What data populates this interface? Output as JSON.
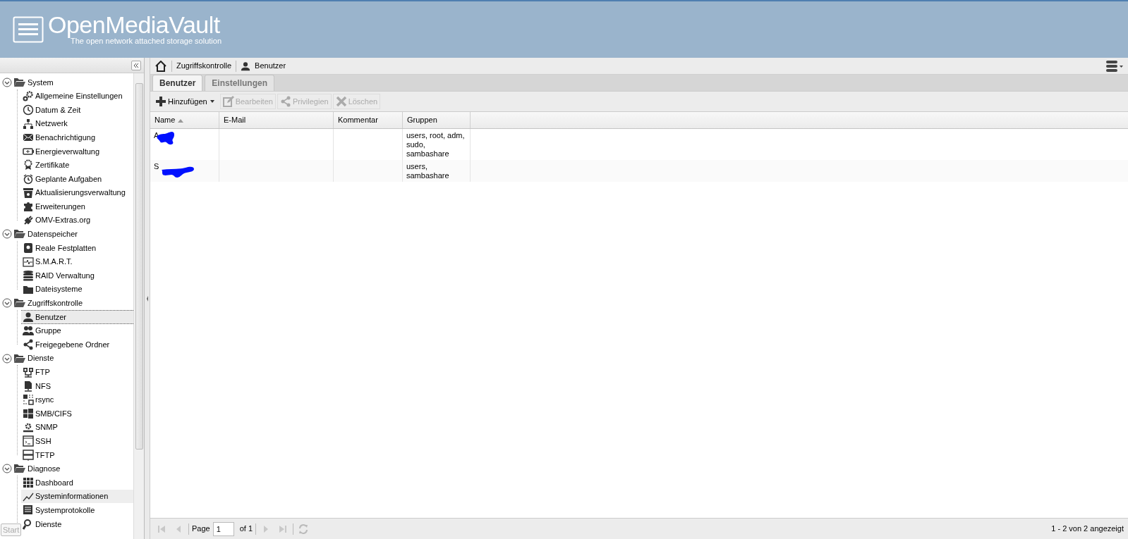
{
  "header": {
    "title": "OpenMediaVault",
    "tagline": "The open network attached storage solution"
  },
  "sidebar": {
    "tree": [
      {
        "label": "System",
        "expanded": true,
        "children": [
          {
            "label": "Allgemeine Einstellungen",
            "selected": false,
            "hovered": false
          },
          {
            "label": "Datum & Zeit",
            "selected": false,
            "hovered": false
          },
          {
            "label": "Netzwerk",
            "selected": false,
            "hovered": false
          },
          {
            "label": "Benachrichtigung",
            "selected": false,
            "hovered": false
          },
          {
            "label": "Energieverwaltung",
            "selected": false,
            "hovered": false
          },
          {
            "label": "Zertifikate",
            "selected": false,
            "hovered": false
          },
          {
            "label": "Geplante Aufgaben",
            "selected": false,
            "hovered": false
          },
          {
            "label": "Aktualisierungsverwaltung",
            "selected": false,
            "hovered": false
          },
          {
            "label": "Erweiterungen",
            "selected": false,
            "hovered": false
          },
          {
            "label": "OMV-Extras.org",
            "selected": false,
            "hovered": false
          }
        ]
      },
      {
        "label": "Datenspeicher",
        "expanded": true,
        "children": [
          {
            "label": "Reale Festplatten",
            "selected": false,
            "hovered": false
          },
          {
            "label": "S.M.A.R.T.",
            "selected": false,
            "hovered": false
          },
          {
            "label": "RAID Verwaltung",
            "selected": false,
            "hovered": false
          },
          {
            "label": "Dateisysteme",
            "selected": false,
            "hovered": false
          }
        ]
      },
      {
        "label": "Zugriffskontrolle",
        "expanded": true,
        "children": [
          {
            "label": "Benutzer",
            "selected": true,
            "hovered": false
          },
          {
            "label": "Gruppe",
            "selected": false,
            "hovered": false
          },
          {
            "label": "Freigegebene Ordner",
            "selected": false,
            "hovered": false
          }
        ]
      },
      {
        "label": "Dienste",
        "expanded": true,
        "children": [
          {
            "label": "FTP",
            "selected": false,
            "hovered": false
          },
          {
            "label": "NFS",
            "selected": false,
            "hovered": false
          },
          {
            "label": "rsync",
            "selected": false,
            "hovered": false
          },
          {
            "label": "SMB/CIFS",
            "selected": false,
            "hovered": false
          },
          {
            "label": "SNMP",
            "selected": false,
            "hovered": false
          },
          {
            "label": "SSH",
            "selected": false,
            "hovered": false
          },
          {
            "label": "TFTP",
            "selected": false,
            "hovered": false
          }
        ]
      },
      {
        "label": "Diagnose",
        "expanded": true,
        "children": [
          {
            "label": "Dashboard",
            "selected": false,
            "hovered": false
          },
          {
            "label": "Systeminformationen",
            "selected": false,
            "hovered": true
          },
          {
            "label": "Systemprotokolle",
            "selected": false,
            "hovered": false
          },
          {
            "label": "Dienste",
            "selected": false,
            "hovered": false
          }
        ]
      }
    ]
  },
  "start_button": "Start",
  "breadcrumb": [
    "Zugriffskontrolle",
    "Benutzer"
  ],
  "tabs": [
    {
      "label": "Benutzer",
      "selected": true
    },
    {
      "label": "Einstellungen",
      "selected": false
    }
  ],
  "toolbar": [
    {
      "label": "Hinzufügen",
      "disabled": false
    },
    {
      "label": "Bearbeiten",
      "disabled": true
    },
    {
      "label": "Privilegien",
      "disabled": true
    },
    {
      "label": "Löschen",
      "disabled": true
    }
  ],
  "table": {
    "columns": [
      {
        "label": "Name",
        "sorted": true
      },
      {
        "label": "E-Mail",
        "sorted": false
      },
      {
        "label": "Kommentar",
        "sorted": false
      },
      {
        "label": "Gruppen",
        "sorted": false
      }
    ],
    "rows": [
      {
        "name": "A",
        "redacted": true,
        "email": "",
        "comment": "",
        "groups": "users, root, adm, sudo, sambashare"
      },
      {
        "name": "S",
        "redacted": true,
        "email": "",
        "comment": "",
        "groups": "users, sambashare"
      }
    ]
  },
  "pager": {
    "page_label": "Page",
    "page": "1",
    "of": "of 1",
    "summary": "1 - 2 von 2 angezeigt"
  }
}
